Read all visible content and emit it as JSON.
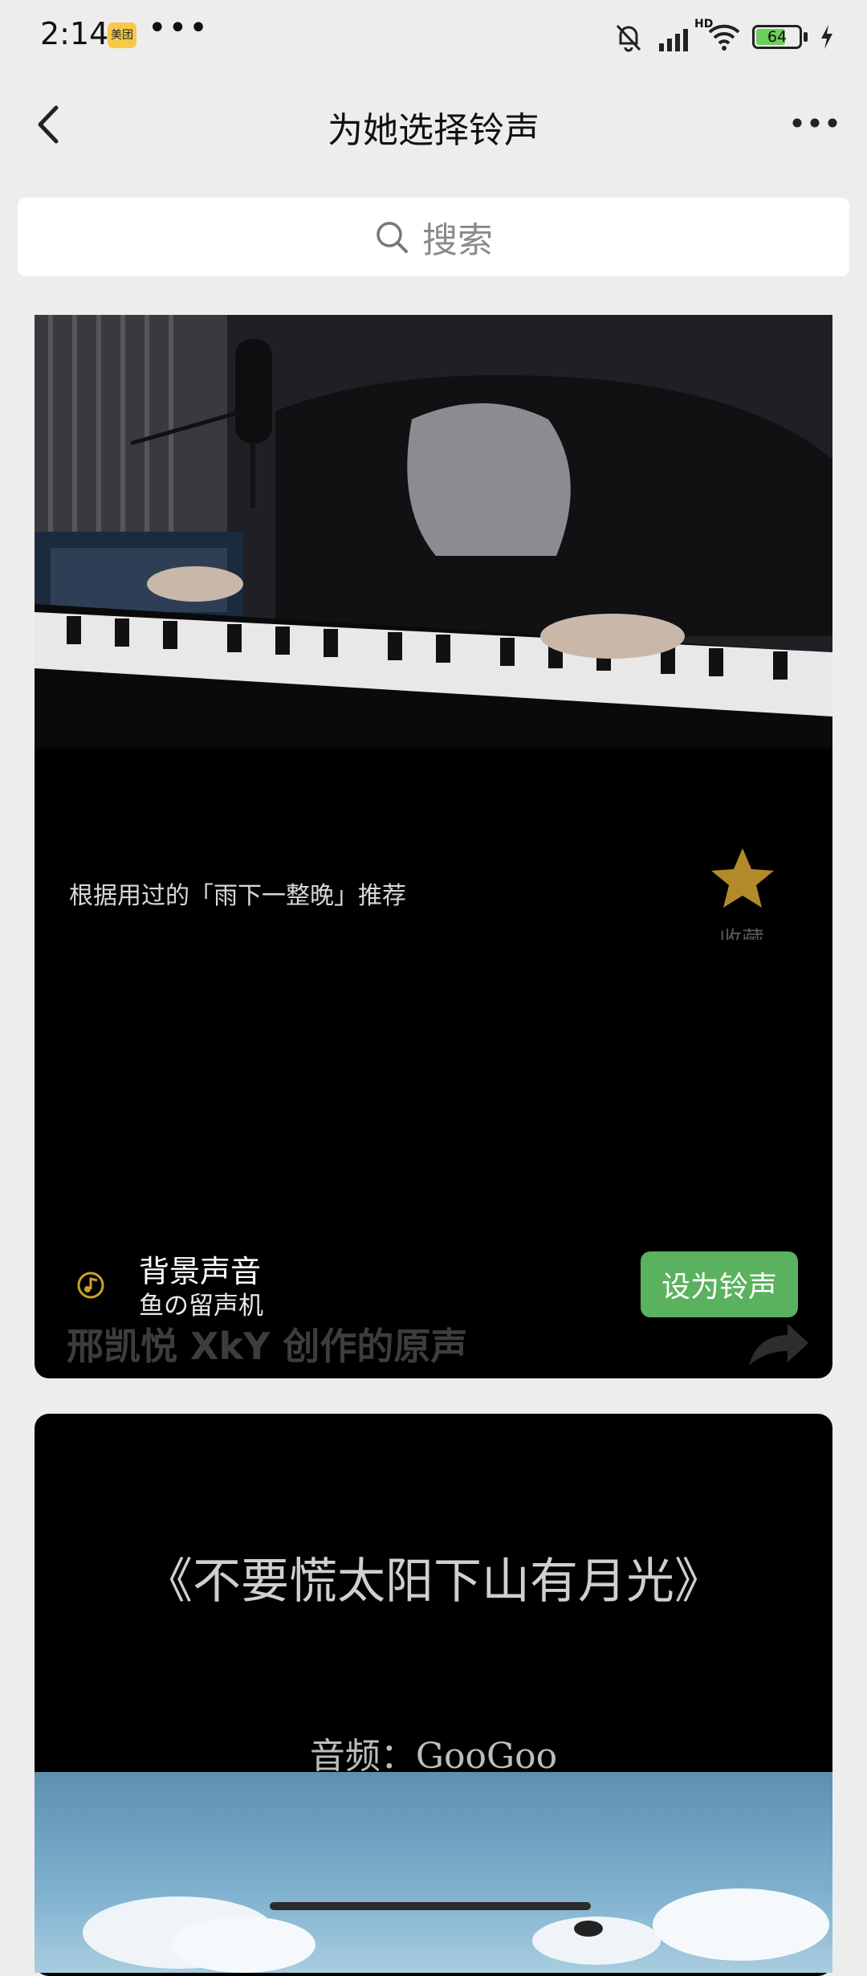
{
  "status_bar": {
    "time": "2:14",
    "app_badge": "美团",
    "more_dots": "•••",
    "network_label": "HD",
    "battery_level": "64"
  },
  "nav": {
    "title": "为她选择铃声",
    "back_icon": "chevron-left-icon",
    "more_icon": "more-horizontal-icon"
  },
  "search": {
    "placeholder": "搜索"
  },
  "cards": [
    {
      "recommend_text": "根据用过的「雨下一整晚」推荐",
      "favorite_label": "收藏",
      "song_title": "背景声音",
      "song_artist": "鱼の留声机",
      "set_button": "设为铃声",
      "video_caption": "邢凯悦 XkY 创作的原声"
    },
    {
      "title": "《不要慌太阳下山有月光》",
      "audio_credit": "音频：GooGoo"
    }
  ],
  "colors": {
    "accent_green": "#5bb25e",
    "background": "#ededed",
    "star_gold": "#b38a2a"
  }
}
